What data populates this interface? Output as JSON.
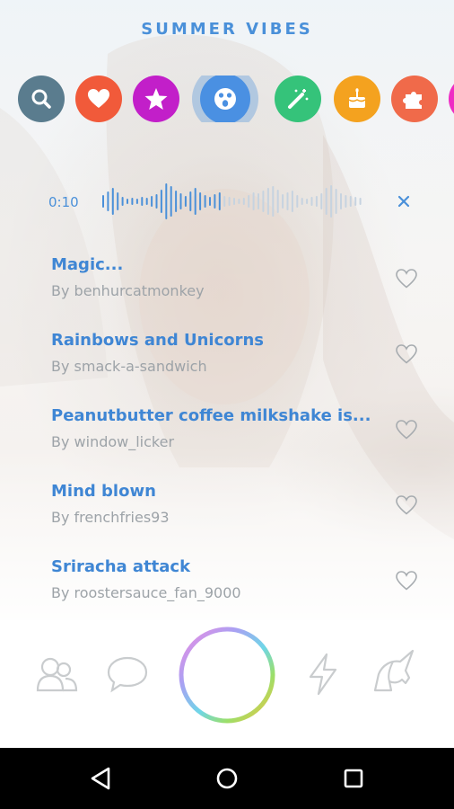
{
  "header": {
    "title": "SUMMER VIBES"
  },
  "filters": [
    {
      "name": "search-icon",
      "color": "#5a7c8e",
      "glyph": "search"
    },
    {
      "name": "heart-icon",
      "color": "#f15a3a",
      "glyph": "heart"
    },
    {
      "name": "star-icon",
      "color": "#c21fc9",
      "glyph": "star"
    },
    {
      "name": "surprised-face-icon",
      "color": "#4a90e2",
      "glyph": "face",
      "selected": true
    },
    {
      "name": "magic-wand-icon",
      "color": "#35c37a",
      "glyph": "wand"
    },
    {
      "name": "cake-icon",
      "color": "#f4a21f",
      "glyph": "cake"
    },
    {
      "name": "puzzle-icon",
      "color": "#f06a4a",
      "glyph": "puzzle"
    },
    {
      "name": "pink-filter-icon",
      "color": "#ee2cc4",
      "glyph": "none"
    }
  ],
  "player": {
    "time": "0:10",
    "progress": 0.45,
    "accent": "#4a90d9"
  },
  "sounds": [
    {
      "title": "Magic...",
      "author": "By benhurcatmonkey"
    },
    {
      "title": "Rainbows and Unicorns",
      "author": "By smack-a-sandwich"
    },
    {
      "title": "Peanutbutter coffee milkshake is...",
      "author": "By window_licker"
    },
    {
      "title": "Mind blown",
      "author": "By frenchfries93"
    },
    {
      "title": "Sriracha attack",
      "author": "By roostersauce_fan_9000"
    }
  ],
  "bottom_icons": [
    "friends-icon",
    "chat-bubble-icon",
    "capture-button",
    "lightning-icon",
    "unicorn-icon"
  ],
  "system_nav": [
    "back-icon",
    "home-icon",
    "recents-icon"
  ]
}
